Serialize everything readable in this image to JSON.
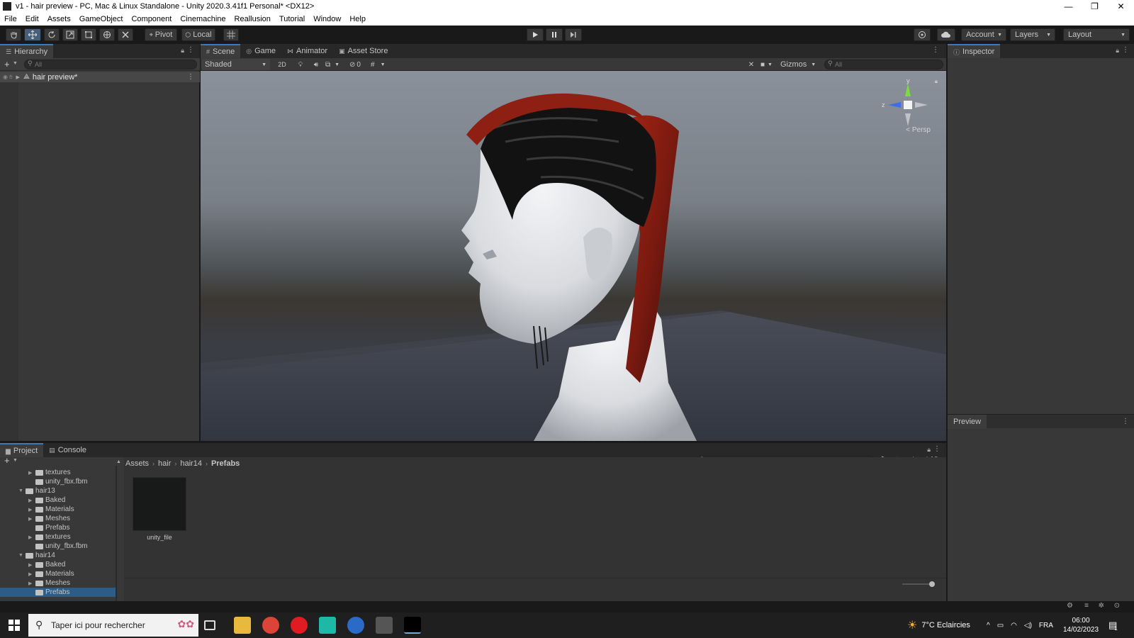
{
  "window": {
    "title": "v1 - hair preview - PC, Mac & Linux Standalone - Unity 2020.3.41f1 Personal* <DX12>",
    "minimize": "—",
    "restore": "❐",
    "close": "✕"
  },
  "menu": [
    "File",
    "Edit",
    "Assets",
    "GameObject",
    "Component",
    "Cinemachine",
    "Reallusion",
    "Tutorial",
    "Window",
    "Help"
  ],
  "toolbar": {
    "pivot": "Pivot",
    "local": "Local",
    "account": "Account",
    "layers": "Layers",
    "layout": "Layout"
  },
  "hierarchy": {
    "tab": "Hierarchy",
    "search_placeholder": "All",
    "scene_item": "hair preview*"
  },
  "scene": {
    "tabs": [
      "Scene",
      "Game",
      "Animator",
      "Asset Store"
    ],
    "shading_mode": "Shaded",
    "mode_2d": "2D",
    "hidden_count": "0",
    "gizmos": "Gizmos",
    "search_placeholder": "All",
    "persp_label": "< Persp",
    "axis_y": "y",
    "axis_z": "z"
  },
  "inspector": {
    "tab": "Inspector",
    "preview": "Preview"
  },
  "project": {
    "tabs": [
      "Project",
      "Console"
    ],
    "badge_count": "10",
    "tree": [
      {
        "label": "textures",
        "indent": 1,
        "arrow": "▶"
      },
      {
        "label": "unity_fbx.fbm",
        "indent": 1,
        "arrow": ""
      },
      {
        "label": "hair13",
        "indent": 0,
        "arrow": "▼"
      },
      {
        "label": "Baked",
        "indent": 1,
        "arrow": "▶"
      },
      {
        "label": "Materials",
        "indent": 1,
        "arrow": "▶"
      },
      {
        "label": "Meshes",
        "indent": 1,
        "arrow": "▶"
      },
      {
        "label": "Prefabs",
        "indent": 1,
        "arrow": ""
      },
      {
        "label": "textures",
        "indent": 1,
        "arrow": "▶"
      },
      {
        "label": "unity_fbx.fbm",
        "indent": 1,
        "arrow": ""
      },
      {
        "label": "hair14",
        "indent": 0,
        "arrow": "▼"
      },
      {
        "label": "Baked",
        "indent": 1,
        "arrow": "▶"
      },
      {
        "label": "Materials",
        "indent": 1,
        "arrow": "▶"
      },
      {
        "label": "Meshes",
        "indent": 1,
        "arrow": "▶"
      },
      {
        "label": "Prefabs",
        "indent": 1,
        "arrow": ""
      }
    ],
    "breadcrumb": [
      "Assets",
      "hair",
      "hair14",
      "Prefabs"
    ],
    "asset_name": "unity_file"
  },
  "taskbar": {
    "search_placeholder": "Taper ici pour rechercher",
    "weather": "7°C  Eclaircies",
    "language": "FRA",
    "time": "06:00",
    "date": "14/02/2023",
    "notification_count": "1"
  }
}
